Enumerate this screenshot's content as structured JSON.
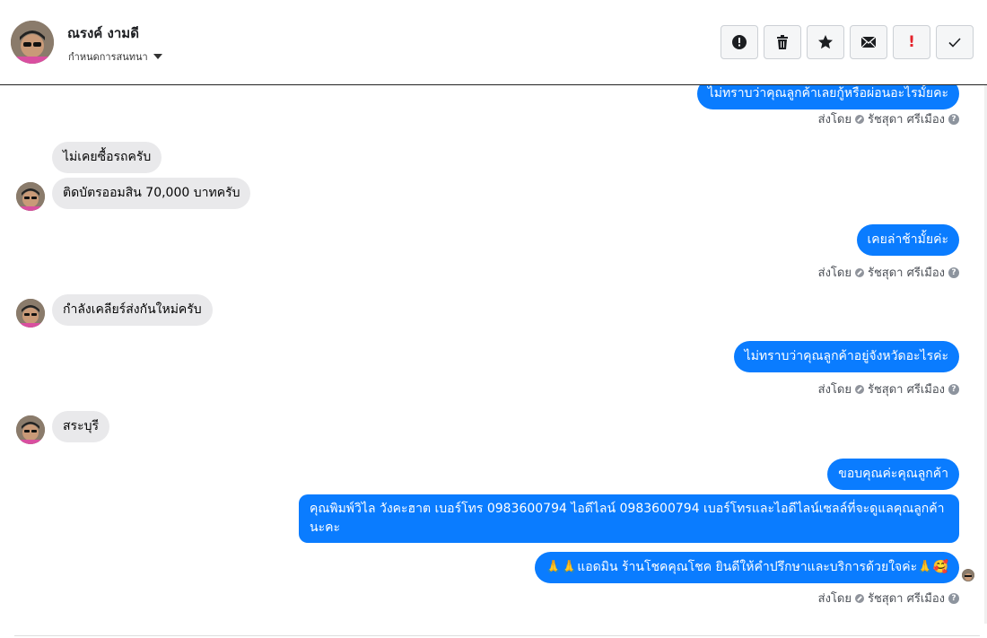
{
  "header": {
    "contact_name": "ณรงค์ งามดี",
    "label_select": "กำหนดการสนทนา",
    "toolbar_icons": [
      "alert-circle-icon",
      "trash-icon",
      "star-icon",
      "envelope-icon",
      "exclamation-icon",
      "check-icon"
    ]
  },
  "messages": [
    {
      "dir": "out",
      "text": "ไม่ทราบว่าคุณลูกค้าเลยกู้หรือผ่อนอะไรมั้ยคะ"
    },
    {
      "dir": "in",
      "text": "ไม่เคยซื้อรถครับ"
    },
    {
      "dir": "in",
      "text": "ติดบัตรออมสิน 70,000 บาทครับ"
    },
    {
      "dir": "out",
      "text": "เคยล่าช้ามั้ยค่ะ"
    },
    {
      "dir": "in",
      "text": "กำลังเคลียร์ส่งกันใหม่ครับ"
    },
    {
      "dir": "out",
      "text": "ไม่ทราบว่าคุณลูกค้าอยู่จังหวัดอะไรค่ะ"
    },
    {
      "dir": "in",
      "text": "สระบุรี"
    },
    {
      "dir": "out",
      "text": "ขอบคุณค่ะคุณลูกค้า"
    },
    {
      "dir": "out",
      "text": "คุณพิมพ์วิไล วังคะฮาต   เบอร์โทร 0983600794  ไอดีไลน์ 0983600794   เบอร์โทรและไอดีไลน์เซลล์ที่จะดูแลคุณลูกค้านะคะ"
    },
    {
      "dir": "out",
      "text": "🙏🙏แอดมิน ร้านโชคคุณโชค ยินดีให้คำปรึกษาและบริการด้วยใจค่ะ🙏🥰"
    }
  ],
  "sent_by": {
    "prefix": "ส่งโดย",
    "name": "รัชสุดา ศรีเมือง"
  },
  "colors": {
    "outgoing_bubble": "#0a7cff",
    "incoming_bubble": "#e9e9eb"
  }
}
